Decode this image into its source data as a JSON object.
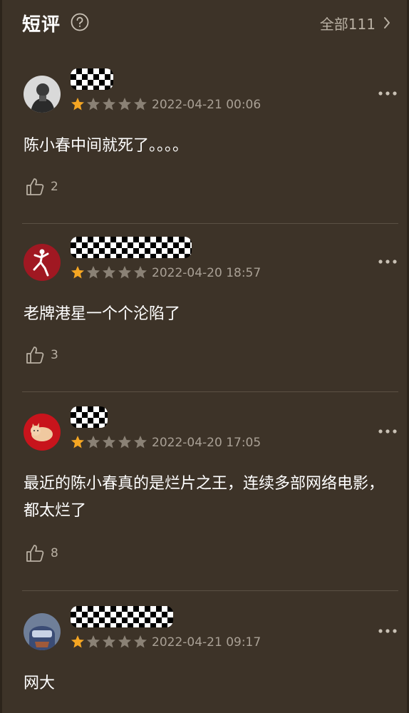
{
  "header": {
    "title": "短评",
    "all_label": "全部111"
  },
  "colors": {
    "background": "#3d3328",
    "star_filled": "#f5a623",
    "star_empty": "#8a8175",
    "muted_text": "#a9a095"
  },
  "comments": [
    {
      "rating": 1,
      "date": "2022-04-21 00:06",
      "text": "陈小春中间就死了。。。。",
      "likes": "2",
      "avatar": "avatar-man-portrait"
    },
    {
      "rating": 1,
      "date": "2022-04-20 18:57",
      "text": "老牌港星一个个沦陷了",
      "likes": "3",
      "avatar": "avatar-red-jumpman"
    },
    {
      "rating": 1,
      "date": "2022-04-20 17:05",
      "text": "最近的陈小春真的是烂片之王，连续多部网络电影，都太烂了",
      "likes": "8",
      "avatar": "avatar-red-cat"
    },
    {
      "rating": 1,
      "date": "2022-04-21 09:17",
      "text": "网大",
      "likes": "",
      "avatar": "avatar-blue-character"
    }
  ]
}
